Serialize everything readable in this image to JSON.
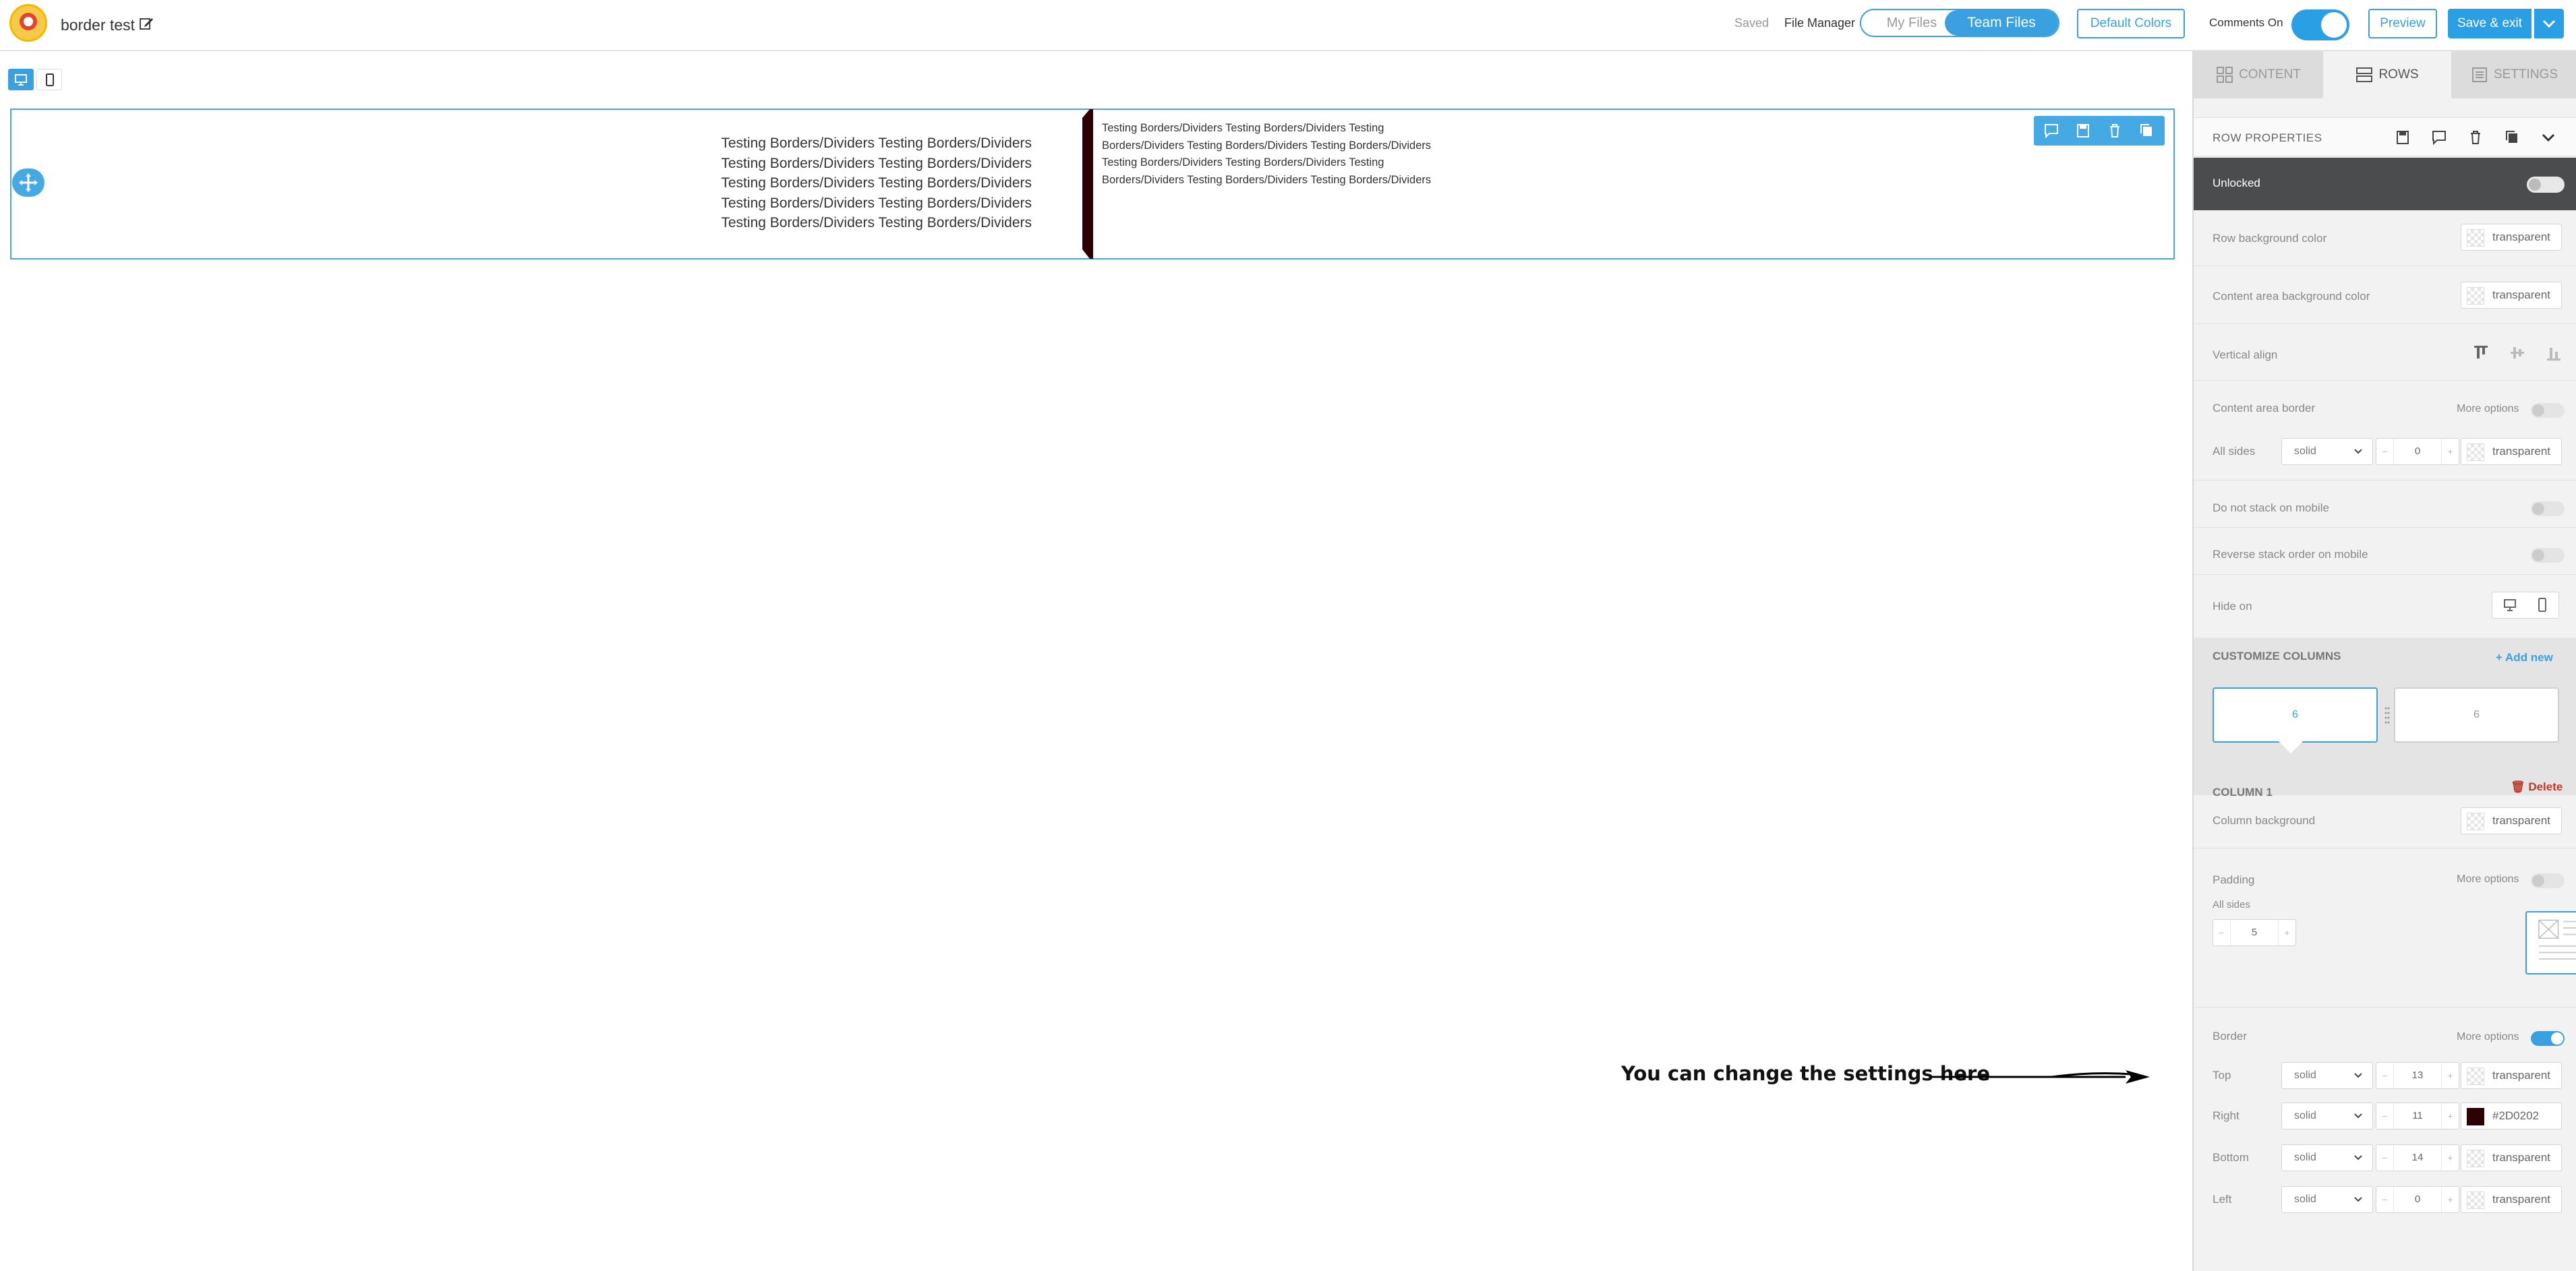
{
  "header": {
    "doc_title": "border test",
    "saved": "Saved",
    "file_manager": "File Manager",
    "my_files": "My Files",
    "team_files": "Team Files",
    "default_colors": "Default Colors",
    "comments_label": "Comments On",
    "comments_on": true,
    "preview": "Preview",
    "save_exit": "Save & exit"
  },
  "canvas": {
    "col1_lines": [
      "Testing Borders/Dividers Testing Borders/Dividers",
      "Testing Borders/Dividers Testing Borders/Dividers",
      "Testing Borders/Dividers Testing Borders/Dividers",
      "Testing Borders/Dividers Testing Borders/Dividers",
      "Testing Borders/Dividers Testing Borders/Dividers"
    ],
    "col2_lines": [
      "Testing Borders/Dividers Testing Borders/Dividers Testing",
      "Borders/Dividers Testing Borders/Dividers Testing Borders/Dividers",
      "Testing Borders/Dividers Testing Borders/Dividers Testing",
      "Borders/Dividers Testing Borders/Dividers Testing Borders/Dividers"
    ],
    "divider_color": "#2D0202",
    "accent": "#45a9e4"
  },
  "annotation": {
    "text": "You can change the settings here"
  },
  "panel": {
    "tabs": [
      {
        "label": "CONTENT",
        "icon": "grid-icon",
        "active": false
      },
      {
        "label": "ROWS",
        "icon": "rows-icon",
        "active": true
      },
      {
        "label": "SETTINGS",
        "icon": "settings-icon",
        "active": false
      }
    ],
    "row_properties": {
      "title": "ROW PROPERTIES",
      "unlocked_label": "Unlocked",
      "row_bg_label": "Row background color",
      "row_bg_value": "transparent",
      "content_bg_label": "Content area background color",
      "content_bg_value": "transparent",
      "vertical_align_label": "Vertical align",
      "content_border_label": "Content area border",
      "more_options": "More options",
      "all_sides_label": "All sides",
      "all_sides_style": "solid",
      "all_sides_width": "0",
      "all_sides_color": "transparent",
      "no_stack_label": "Do not stack on mobile",
      "reverse_stack_label": "Reverse stack order on mobile",
      "hide_on_label": "Hide on"
    },
    "customize_columns": {
      "title": "CUSTOMIZE COLUMNS",
      "add_new": "Add new",
      "col_a": "6",
      "col_b": "6"
    },
    "column1": {
      "title": "COLUMN 1",
      "delete": "Delete",
      "bg_label": "Column background",
      "bg_value": "transparent",
      "padding_label": "Padding",
      "more_options": "More options",
      "padding_all_sides": "All sides",
      "padding_value": "5",
      "border_label": "Border",
      "border_more_options": "More options",
      "border_more_on": true,
      "borders": [
        {
          "side": "Top",
          "style": "solid",
          "width": "13",
          "color": "transparent"
        },
        {
          "side": "Right",
          "style": "solid",
          "width": "11",
          "color": "#2D0202"
        },
        {
          "side": "Bottom",
          "style": "solid",
          "width": "14",
          "color": "transparent"
        },
        {
          "side": "Left",
          "style": "solid",
          "width": "0",
          "color": "transparent"
        }
      ]
    }
  }
}
